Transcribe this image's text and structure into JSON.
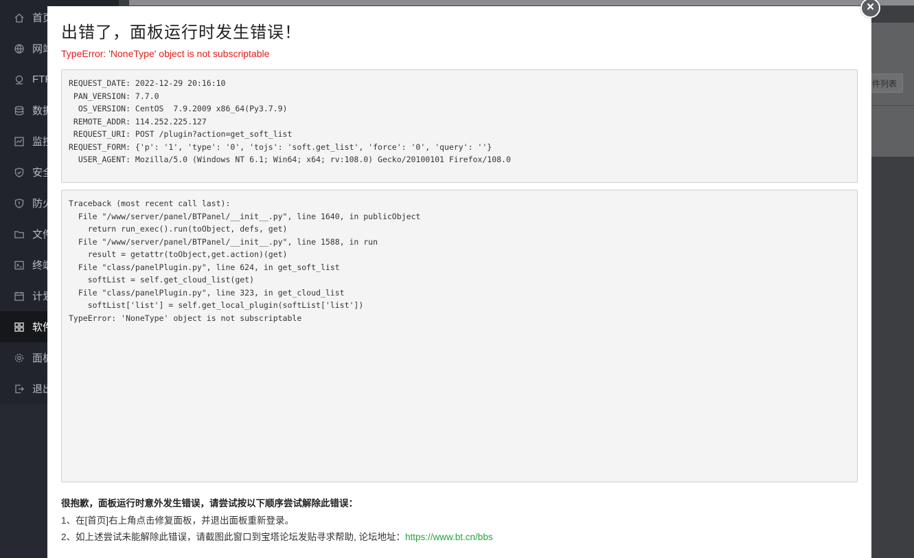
{
  "sidebar": {
    "items": [
      {
        "label": "首页",
        "icon": "home-icon"
      },
      {
        "label": "网站",
        "icon": "globe-icon"
      },
      {
        "label": "FTP",
        "icon": "ftp-icon"
      },
      {
        "label": "数据",
        "icon": "database-icon"
      },
      {
        "label": "监控",
        "icon": "monitor-icon"
      },
      {
        "label": "安全",
        "icon": "shield-icon"
      },
      {
        "label": "防火",
        "icon": "firewall-icon"
      },
      {
        "label": "文件",
        "icon": "folder-icon"
      },
      {
        "label": "终端",
        "icon": "terminal-icon"
      },
      {
        "label": "计划",
        "icon": "calendar-icon"
      },
      {
        "label": "软件",
        "icon": "apps-icon"
      },
      {
        "label": "面板",
        "icon": "gear-icon"
      },
      {
        "label": "退出",
        "icon": "logout-icon"
      }
    ],
    "active_index": 10
  },
  "background": {
    "button_label": "件列表"
  },
  "modal": {
    "close_label": "×",
    "title": "出错了，面板运行时发生错误！",
    "error": "TypeError: 'NoneType' object is not subscriptable",
    "request_info": [
      "REQUEST_DATE: 2022-12-29 20:16:10",
      " PAN_VERSION: 7.7.0",
      "  OS_VERSION: CentOS  7.9.2009 x86_64(Py3.7.9)",
      " REMOTE_ADDR: 114.252.225.127",
      " REQUEST_URI: POST /plugin?action=get_soft_list",
      "REQUEST_FORM: {'p': '1', 'type': '0', 'tojs': 'soft.get_list', 'force': '0', 'query': ''}",
      "  USER_AGENT: Mozilla/5.0 (Windows NT 6.1; Win64; x64; rv:108.0) Gecko/20100101 Firefox/108.0"
    ],
    "traceback": [
      "Traceback (most recent call last):",
      "  File \"/www/server/panel/BTPanel/__init__.py\", line 1640, in publicObject",
      "    return run_exec().run(toObject, defs, get)",
      "  File \"/www/server/panel/BTPanel/__init__.py\", line 1588, in run",
      "    result = getattr(toObject,get.action)(get)",
      "  File \"class/panelPlugin.py\", line 624, in get_soft_list",
      "    softList = self.get_cloud_list(get)",
      "  File \"class/panelPlugin.py\", line 323, in get_cloud_list",
      "    softList['list'] = self.get_local_plugin(softList['list'])",
      "TypeError: 'NoneType' object is not subscriptable"
    ],
    "help_title": "很抱歉，面板运行时意外发生错误，请尝试按以下顺序尝试解除此错误：",
    "help_line1": "1、在[首页]右上角点击修复面板，并退出面板重新登录。",
    "help_line2": "2、如上述尝试未能解除此错误，请截图此窗口到宝塔论坛发贴寻求帮助, 论坛地址：",
    "forum_link": "https://www.bt.cn/bbs"
  }
}
